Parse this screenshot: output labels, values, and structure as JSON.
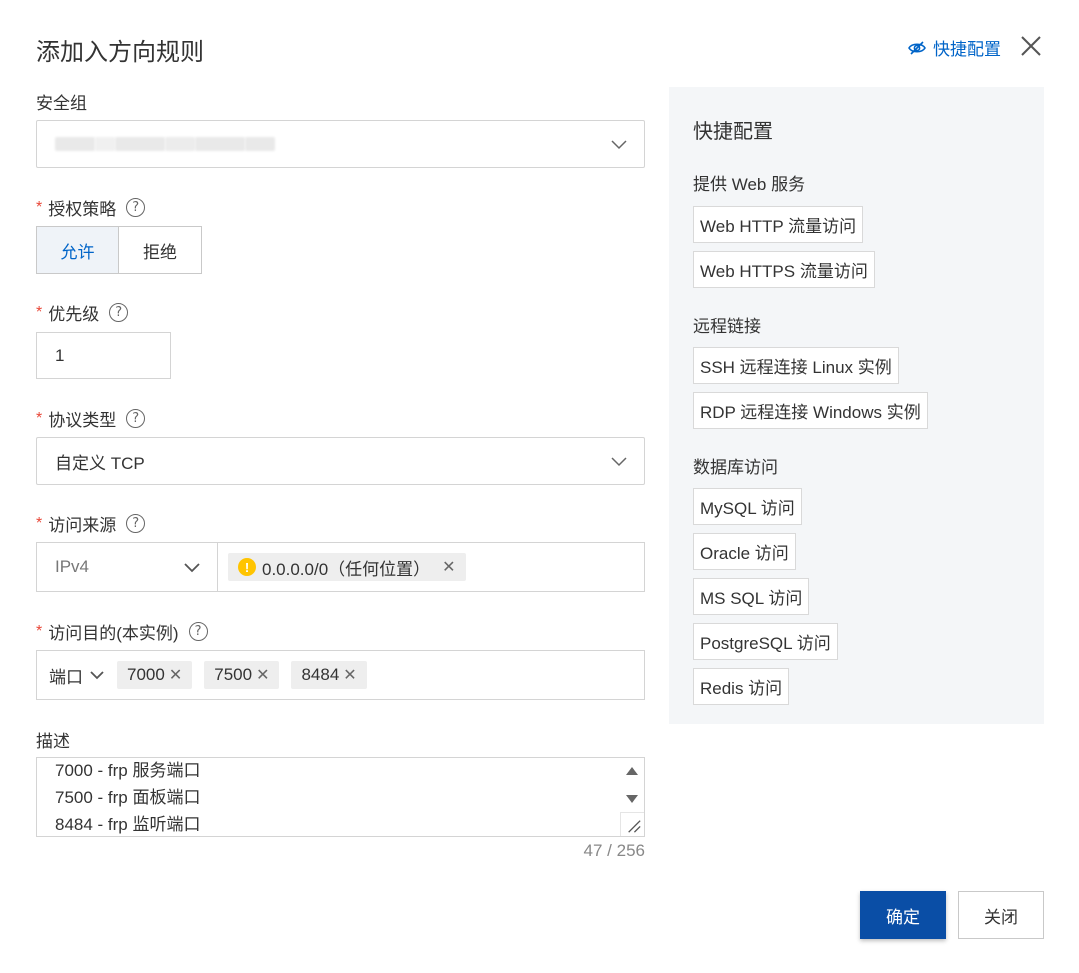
{
  "dialog": {
    "title": "添加入方向规则",
    "quick_config_link": "快捷配置"
  },
  "form": {
    "security_group": {
      "label": "安全组"
    },
    "auth_policy": {
      "label": "授权策略",
      "options": [
        "允许",
        "拒绝"
      ],
      "selected": "允许"
    },
    "priority": {
      "label": "优先级",
      "value": "1"
    },
    "protocol": {
      "label": "协议类型",
      "value": "自定义 TCP"
    },
    "source": {
      "label": "访问来源",
      "type": "IPv4",
      "tags": [
        "0.0.0.0/0（任何位置）"
      ]
    },
    "destination": {
      "label": "访问目的(本实例)",
      "type": "端口",
      "ports": [
        "7000",
        "7500",
        "8484"
      ]
    },
    "description": {
      "label": "描述",
      "lines": [
        "7000 - frp 服务端口",
        "7500 - frp 面板端口",
        "8484 - frp 监听端口"
      ],
      "count": "47 / 256"
    }
  },
  "quick_panel": {
    "title": "快捷配置",
    "groups": [
      {
        "title": "提供 Web 服务",
        "items": [
          "Web HTTP 流量访问",
          "Web HTTPS 流量访问"
        ]
      },
      {
        "title": "远程链接",
        "items": [
          "SSH 远程连接 Linux 实例",
          "RDP 远程连接 Windows 实例"
        ]
      },
      {
        "title": "数据库访问",
        "items": [
          "MySQL 访问",
          "Oracle 访问",
          "MS SQL 访问",
          "PostgreSQL 访问",
          "Redis 访问"
        ]
      }
    ]
  },
  "footer": {
    "ok_label": "确定",
    "close_label": "关闭"
  },
  "colors": {
    "primary": "#0a4ea6",
    "link": "#0064c8",
    "required": "#e84738",
    "warning": "#ffc400"
  }
}
